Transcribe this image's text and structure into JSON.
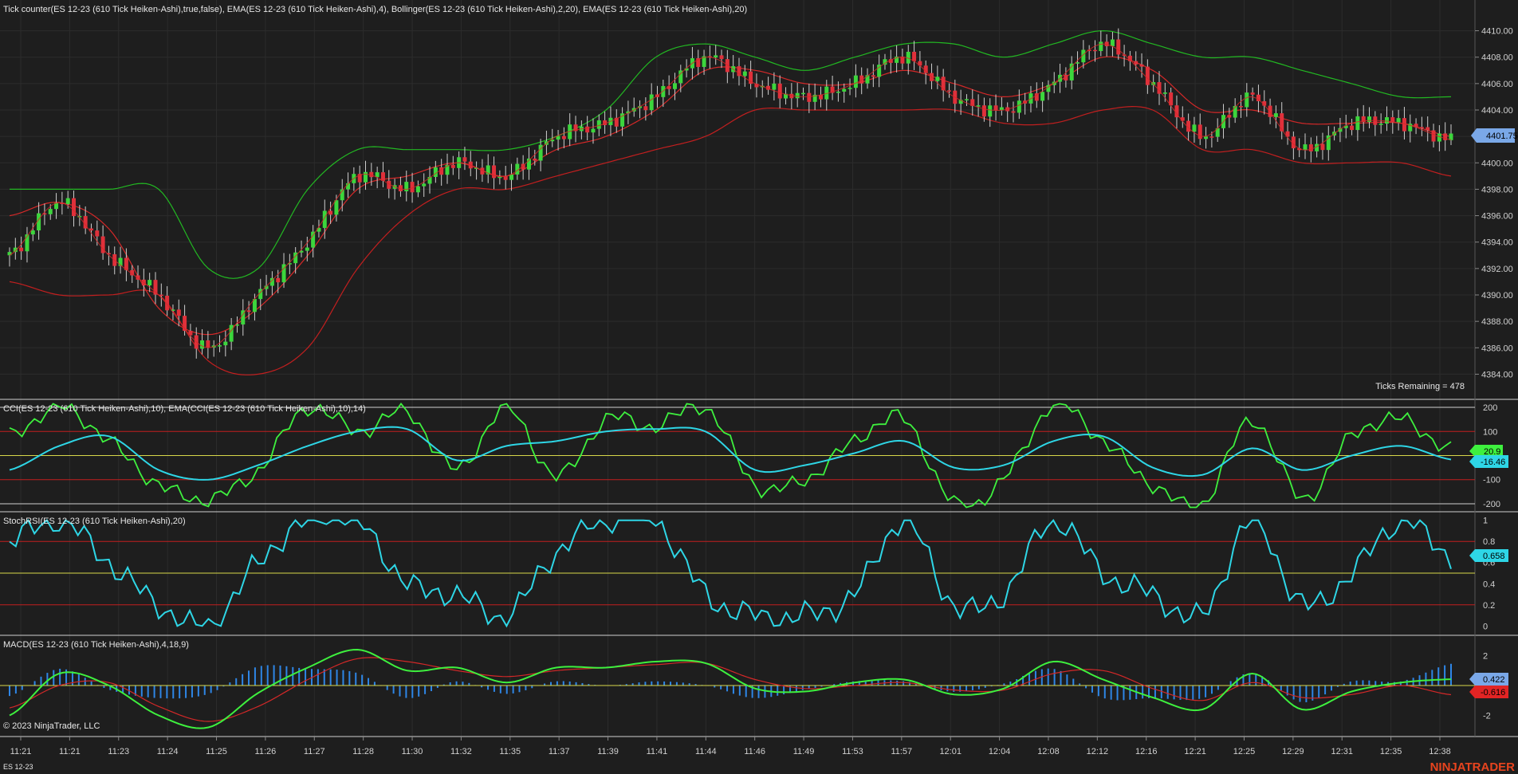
{
  "instrument_label": "ES 12-23",
  "copyright": "© 2023 NinjaTrader, LLC",
  "brand": "NINJATRADER",
  "colors": {
    "background": "#1e1e1e",
    "up_candle": "#3cd63c",
    "down_candle": "#e0303a",
    "band_upper": "#22b822",
    "band_lower": "#c21f1f",
    "ema_fast": "#d42828",
    "cci": "#3ef03e",
    "cci_ema": "#2ed6e6",
    "stoch_rsi": "#2ed6e6",
    "macd_line": "#3ef03e",
    "macd_signal": "#d42828",
    "macd_hist": "#2e86e6",
    "neutral_line": "#d8d84a",
    "level_line": "#c21f1f",
    "price_tag": "#7aa8e8"
  },
  "panels": {
    "price": {
      "title": "Tick counter(ES 12-23 (610 Tick Heiken-Ashi),true,false), EMA(ES 12-23 (610 Tick Heiken-Ashi),4), Bollinger(ES 12-23 (610 Tick Heiken-Ashi),2,20), EMA(ES 12-23 (610 Tick Heiken-Ashi),20)",
      "y_ticks": [
        "4410.00",
        "4408.00",
        "4406.00",
        "4404.00",
        "4402.00",
        "4400.00",
        "4398.00",
        "4396.00",
        "4394.00",
        "4392.00",
        "4390.00",
        "4388.00",
        "4386.00",
        "4384.00"
      ],
      "last_price": "4401.75",
      "ticks_remaining": "Ticks Remaining = 478"
    },
    "cci": {
      "title": "CCI(ES 12-23 (610 Tick Heiken-Ashi),10), EMA(CCI(ES 12-23 (610 Tick Heiken-Ashi),10),14)",
      "y_ticks": [
        "200",
        "100",
        "-100",
        "-200"
      ],
      "last_cci": "20.9",
      "last_ema": "-16.46"
    },
    "stoch": {
      "title": "StochRSI(ES 12-23 (610 Tick Heiken-Ashi),20)",
      "y_ticks": [
        "1",
        "0.8",
        "0.6",
        "0.4",
        "0.2",
        "0"
      ],
      "last": "0.658"
    },
    "macd": {
      "title": "MACD(ES 12-23 (610 Tick Heiken-Ashi),4,18,9)",
      "y_ticks": [
        "2",
        "-2"
      ],
      "last_macd": "0.422",
      "last_signal": "-0.616"
    }
  },
  "x_ticks": [
    "11:21",
    "11:21",
    "11:23",
    "11:24",
    "11:25",
    "11:26",
    "11:27",
    "11:28",
    "11:30",
    "11:32",
    "11:35",
    "11:37",
    "11:39",
    "11:41",
    "11:44",
    "11:46",
    "11:49",
    "11:53",
    "11:57",
    "12:01",
    "12:04",
    "12:08",
    "12:12",
    "12:16",
    "12:21",
    "12:25",
    "12:29",
    "12:31",
    "12:35",
    "12:38"
  ],
  "chart_data": [
    {
      "type": "line",
      "title": "Tick counter(ES 12-23 (610 Tick Heiken-Ashi),true,false), EMA(ES 12-23 (610 Tick Heiken-Ashi),4), Bollinger(ES 12-23 (610 Tick Heiken-Ashi),2,20), EMA(ES 12-23 (610 Tick Heiken-Ashi),20)",
      "x_type": "time",
      "ylim": [
        4383,
        4411
      ],
      "x": [
        "11:21",
        "11:21",
        "11:23",
        "11:24",
        "11:25",
        "11:26",
        "11:27",
        "11:28",
        "11:30",
        "11:32",
        "11:35",
        "11:37",
        "11:39",
        "11:41",
        "11:44",
        "11:46",
        "11:49",
        "11:53",
        "11:57",
        "12:01",
        "12:04",
        "12:08",
        "12:12",
        "12:16",
        "12:21",
        "12:25",
        "12:29",
        "12:31",
        "12:35",
        "12:38"
      ],
      "series": [
        {
          "values": [
            4393,
            4397,
            4393,
            4390,
            4386,
            4390,
            4394,
            4399,
            4398,
            4400,
            4399,
            4402,
            4403,
            4405,
            4408,
            4406,
            4405,
            4406,
            4408,
            4405,
            4404,
            4406,
            4409,
            4406,
            4402,
            4405,
            4401,
            4403,
            4403,
            4401.75
          ]
        },
        {
          "values": [
            4396,
            4397,
            4395,
            4389,
            4387,
            4389,
            4393,
            4398,
            4399,
            4400,
            4399,
            4401,
            4402,
            4404,
            4407,
            4407,
            4406,
            4406,
            4407,
            4406,
            4405,
            4406,
            4408,
            4407,
            4404,
            4404,
            4403,
            4403,
            4403,
            4402
          ]
        },
        {
          "values": [
            4398,
            4398,
            4398,
            4398,
            4392,
            4392,
            4398,
            4401,
            4401,
            4401,
            4401,
            4402,
            4404,
            4408,
            4409,
            4408,
            4407,
            4408,
            4409,
            4409,
            4408,
            4409,
            4410,
            4409,
            4408,
            4408,
            4407,
            4406,
            4405,
            4405
          ]
        },
        {
          "values": [
            4391,
            4390,
            4390,
            4390,
            4385,
            4384,
            4386,
            4392,
            4396,
            4398,
            4398,
            4399,
            4400,
            4401,
            4402,
            4404,
            4404,
            4404,
            4404,
            4404,
            4403,
            4403,
            4404,
            4404,
            4401,
            4401,
            4400,
            4400,
            4400,
            4399
          ]
        }
      ]
    },
    {
      "type": "line",
      "title": "CCI(ES 12-23 (610 Tick Heiken-Ashi),10), EMA(CCI(ES 12-23 (610 Tick Heiken-Ashi),10),14)",
      "ylim": [
        -220,
        220
      ],
      "x": [
        "11:21",
        "11:21",
        "11:23",
        "11:24",
        "11:25",
        "11:26",
        "11:27",
        "11:28",
        "11:30",
        "11:32",
        "11:35",
        "11:37",
        "11:39",
        "11:41",
        "11:44",
        "11:46",
        "11:49",
        "11:53",
        "11:57",
        "12:01",
        "12:04",
        "12:08",
        "12:12",
        "12:16",
        "12:21",
        "12:25",
        "12:29",
        "12:31",
        "12:35",
        "12:38"
      ],
      "series": [
        {
          "values": [
            80,
            200,
            60,
            -120,
            -180,
            -60,
            200,
            100,
            180,
            -60,
            200,
            -90,
            150,
            120,
            200,
            -120,
            -100,
            60,
            150,
            -200,
            -100,
            210,
            60,
            -120,
            -200,
            150,
            -180,
            80,
            150,
            20.9
          ]
        },
        {
          "values": [
            -60,
            40,
            80,
            -60,
            -100,
            -40,
            40,
            100,
            110,
            -20,
            40,
            60,
            100,
            110,
            100,
            -60,
            -40,
            10,
            60,
            -50,
            -40,
            60,
            80,
            -50,
            -80,
            30,
            -60,
            0,
            40,
            -16.46
          ]
        }
      ]
    },
    {
      "type": "line",
      "title": "StochRSI(ES 12-23 (610 Tick Heiken-Ashi),20)",
      "ylim": [
        0,
        1
      ],
      "x": [
        "11:21",
        "11:21",
        "11:23",
        "11:24",
        "11:25",
        "11:26",
        "11:27",
        "11:28",
        "11:30",
        "11:32",
        "11:35",
        "11:37",
        "11:39",
        "11:41",
        "11:44",
        "11:46",
        "11:49",
        "11:53",
        "11:57",
        "12:01",
        "12:04",
        "12:08",
        "12:12",
        "12:16",
        "12:21",
        "12:25",
        "12:29",
        "12:31",
        "12:35",
        "12:38"
      ],
      "series": [
        {
          "values": [
            0.8,
            1,
            0.6,
            0.2,
            0,
            0.6,
            1,
            1,
            0.4,
            0.3,
            0.1,
            0.7,
            1,
            1,
            0.3,
            0.1,
            0.1,
            0.3,
            1,
            0.2,
            0.3,
            1,
            0.5,
            0.3,
            0.1,
            1,
            0.2,
            0.5,
            1,
            0.658
          ]
        }
      ]
    },
    {
      "type": "line",
      "title": "MACD(ES 12-23 (610 Tick Heiken-Ashi),4,18,9)",
      "ylim": [
        -3.2,
        3.2
      ],
      "x": [
        "11:21",
        "11:21",
        "11:23",
        "11:24",
        "11:25",
        "11:26",
        "11:27",
        "11:28",
        "11:30",
        "11:32",
        "11:35",
        "11:37",
        "11:39",
        "11:41",
        "11:44",
        "11:46",
        "11:49",
        "11:53",
        "11:57",
        "12:01",
        "12:04",
        "12:08",
        "12:12",
        "12:16",
        "12:21",
        "12:25",
        "12:29",
        "12:31",
        "12:35",
        "12:38"
      ],
      "series": [
        {
          "values": [
            -2,
            0.8,
            0,
            -2,
            -2.8,
            -0.5,
            1.2,
            2.4,
            1.0,
            1.2,
            0.2,
            1.2,
            1.2,
            1.6,
            1.5,
            -0.2,
            -0.4,
            0.2,
            0.4,
            -0.6,
            -0.2,
            1.6,
            0.4,
            -0.8,
            -1.6,
            0.8,
            -1.6,
            -0.4,
            0.2,
            0.422
          ]
        },
        {
          "values": [
            -1.5,
            0,
            0.2,
            -1.4,
            -2.4,
            -1.4,
            0.4,
            1.8,
            1.6,
            1.0,
            0.6,
            1.0,
            1.2,
            1.4,
            1.5,
            0.4,
            -0.2,
            0,
            0.2,
            -0.3,
            -0.3,
            0.8,
            1.0,
            -0.2,
            -1.0,
            0.2,
            -0.8,
            -0.6,
            0,
            -0.616
          ]
        }
      ]
    }
  ]
}
